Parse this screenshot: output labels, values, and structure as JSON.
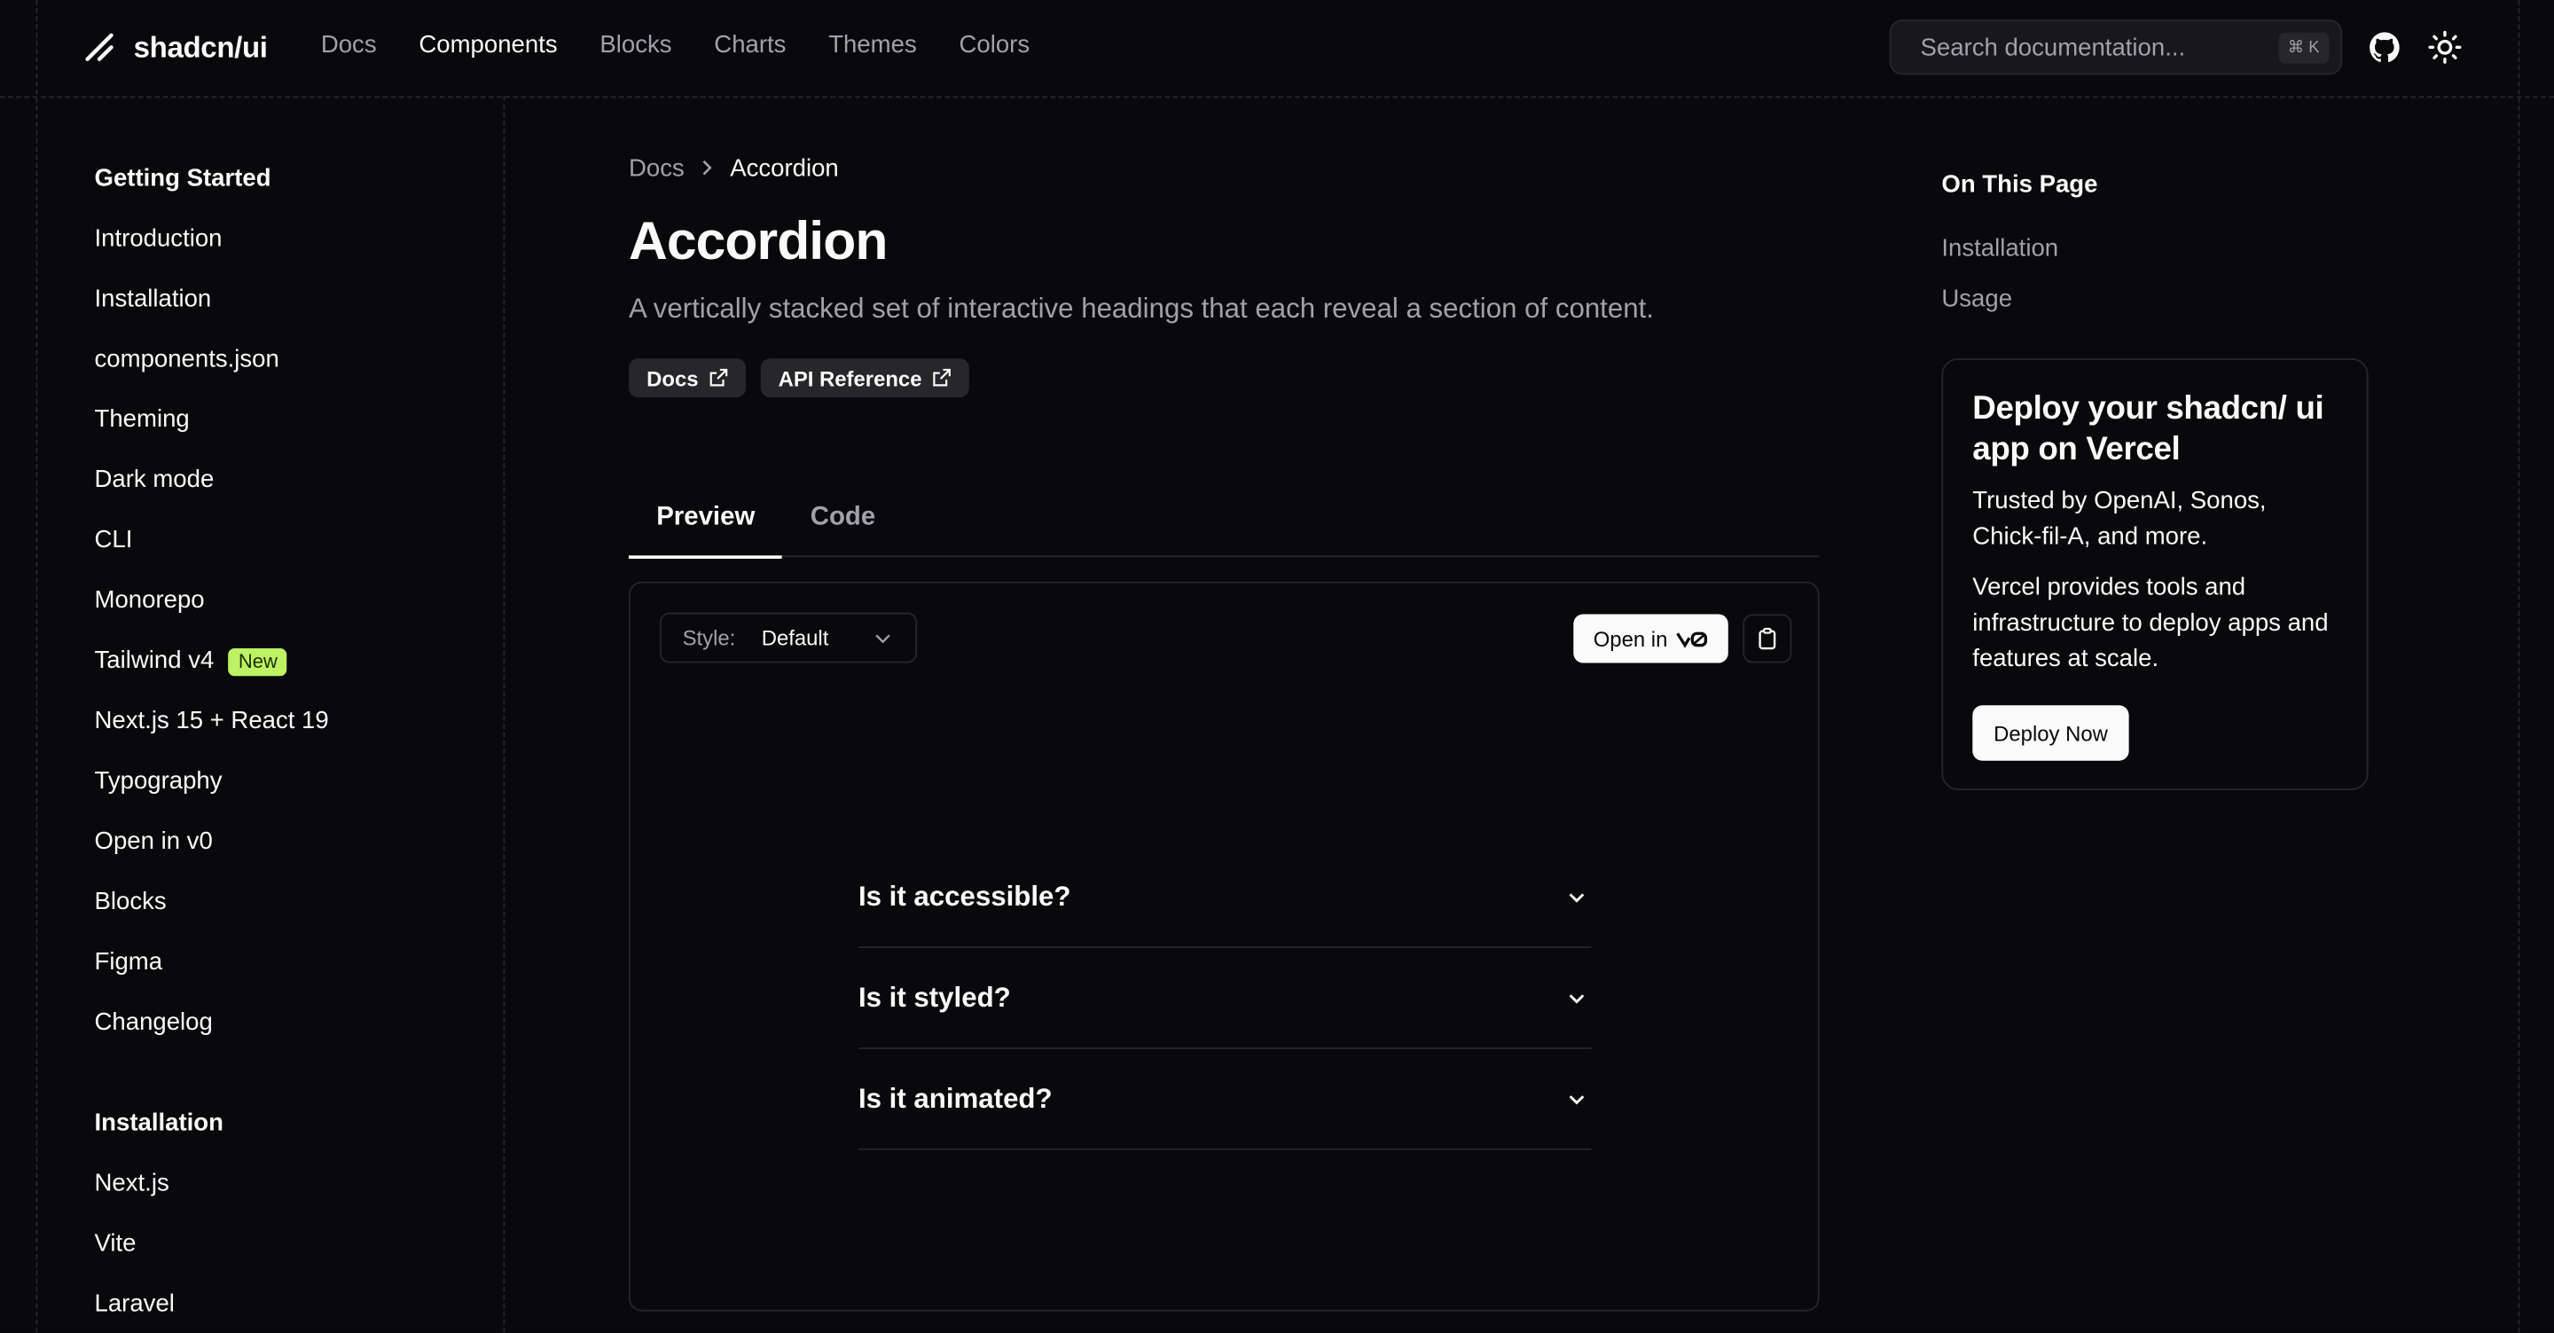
{
  "brand": {
    "name": "shadcn/ui"
  },
  "nav": {
    "items": [
      "Docs",
      "Components",
      "Blocks",
      "Charts",
      "Themes",
      "Colors"
    ],
    "active": "Components"
  },
  "search": {
    "placeholder": "Search documentation...",
    "shortcut": "⌘ K"
  },
  "header_icons": [
    "github-icon",
    "sun-icon"
  ],
  "sidebar": {
    "getting_started": {
      "title": "Getting Started",
      "items": [
        {
          "label": "Introduction"
        },
        {
          "label": "Installation"
        },
        {
          "label": "components.json"
        },
        {
          "label": "Theming"
        },
        {
          "label": "Dark mode"
        },
        {
          "label": "CLI"
        },
        {
          "label": "Monorepo"
        },
        {
          "label": "Tailwind v4",
          "badge": "New"
        },
        {
          "label": "Next.js 15 + React 19"
        },
        {
          "label": "Typography"
        },
        {
          "label": "Open in v0"
        },
        {
          "label": "Blocks"
        },
        {
          "label": "Figma"
        },
        {
          "label": "Changelog"
        }
      ]
    },
    "installation": {
      "title": "Installation",
      "items": [
        {
          "label": "Next.js"
        },
        {
          "label": "Vite"
        },
        {
          "label": "Laravel"
        }
      ]
    }
  },
  "breadcrumb": {
    "parent": "Docs",
    "current": "Accordion"
  },
  "page": {
    "title": "Accordion",
    "description": "A vertically stacked set of interactive headings that each reveal a section of content.",
    "chips": {
      "docs": "Docs",
      "api": "API Reference"
    }
  },
  "tabs": {
    "preview": "Preview",
    "code": "Code",
    "active": "Preview"
  },
  "preview": {
    "style_label": "Style:",
    "style_value": "Default",
    "open_in": "Open in",
    "accordion": [
      {
        "question": "Is it accessible?"
      },
      {
        "question": "Is it styled?"
      },
      {
        "question": "Is it animated?"
      }
    ]
  },
  "toc": {
    "title": "On This Page",
    "items": [
      "Installation",
      "Usage"
    ]
  },
  "promo": {
    "title": "Deploy your shadcn/ ui app on Vercel",
    "line1": "Trusted by OpenAI, Sonos, Chick-fil-A, and more.",
    "line2": "Vercel provides tools and infrastructure to deploy apps and features at scale.",
    "button": "Deploy Now"
  },
  "colors": {
    "background": "#09090b",
    "border": "#27272a",
    "muted": "#a1a1aa",
    "badge": "#bef264"
  }
}
